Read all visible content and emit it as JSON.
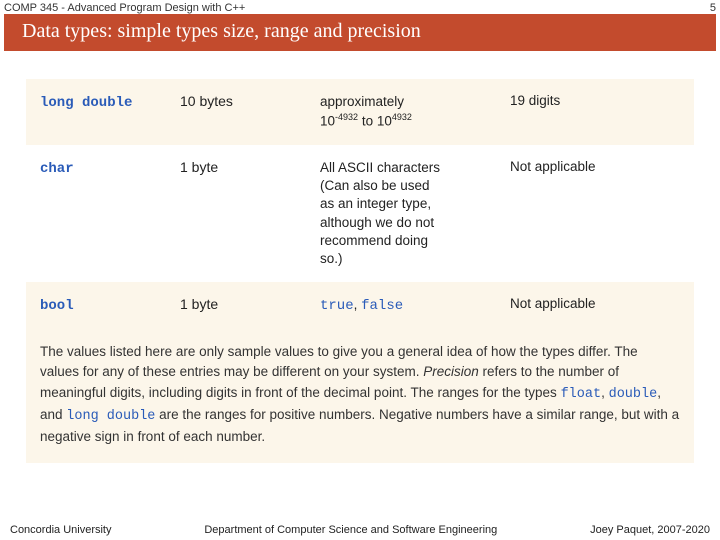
{
  "header": {
    "course": "COMP 345 - Advanced Program Design with C++",
    "page": "5"
  },
  "title": "Data types: simple types size, range and precision",
  "rows": [
    {
      "type": "long double",
      "size": "10 bytes",
      "range_html": "approximately<br>10<sup>-4932</sup> to 10<sup>4932</sup>",
      "precision": "19 digits",
      "bg": "alt"
    },
    {
      "type": "char",
      "size": "1 byte",
      "range_html": "All ASCII characters<br>(Can also be used<br>as an integer type,<br>although we do not<br>recommend doing<br>so.)",
      "precision": "Not applicable",
      "bg": "white"
    },
    {
      "type": "bool",
      "size": "1 byte",
      "range_html": "<span class='kw2'>true</span>, <span class='kw2'>false</span>",
      "precision": "Not applicable",
      "bg": "alt"
    }
  ],
  "caption": {
    "t1": "The values listed here are only sample values to give you a general idea of how the types differ. The values for any of these entries may be different on your system. ",
    "em": "Precision",
    "t2": " refers to the number of meaningful digits, including digits in front of the decimal point. The ranges for the types ",
    "m1": "float",
    "t3": ", ",
    "m2": "double",
    "t4": ", and ",
    "m3": "long double",
    "t5": " are the ranges for positive numbers. Negative numbers have a similar range, but with a negative sign in front of each number."
  },
  "footer": {
    "left": "Concordia University",
    "center": "Department of Computer Science and Software Engineering",
    "right": "Joey Paquet, 2007-2020"
  }
}
